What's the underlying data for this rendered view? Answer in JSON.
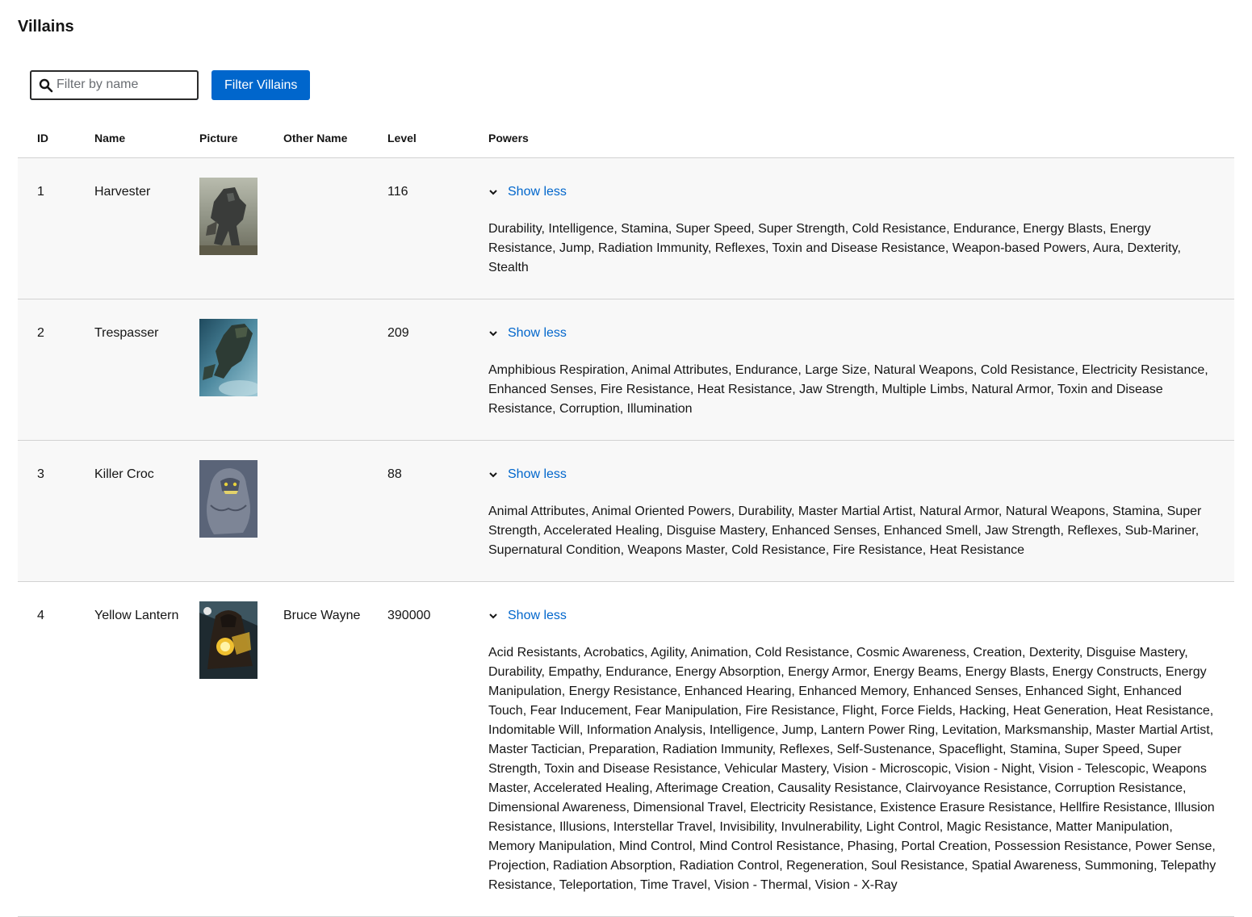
{
  "page": {
    "title": "Villains"
  },
  "toolbar": {
    "search_placeholder": "Filter by name",
    "search_value": "",
    "filter_button_label": "Filter Villains"
  },
  "table": {
    "columns": [
      "ID",
      "Name",
      "Picture",
      "Other Name",
      "Level",
      "Powers"
    ],
    "rows": [
      {
        "id": "1",
        "name": "Harvester",
        "other_name": "",
        "level": "116",
        "toggle_label": "Show less",
        "powers": "Durability, Intelligence, Stamina, Super Speed, Super Strength, Cold Resistance, Endurance, Energy Blasts, Energy Resistance, Jump, Radiation Immunity, Reflexes, Toxin and Disease Resistance, Weapon-based Powers, Aura, Dexterity, Stealth"
      },
      {
        "id": "2",
        "name": "Trespasser",
        "other_name": "",
        "level": "209",
        "toggle_label": "Show less",
        "powers": "Amphibious Respiration, Animal Attributes, Endurance, Large Size, Natural Weapons, Cold Resistance, Electricity Resistance, Enhanced Senses, Fire Resistance, Heat Resistance, Jaw Strength, Multiple Limbs, Natural Armor, Toxin and Disease Resistance, Corruption, Illumination"
      },
      {
        "id": "3",
        "name": "Killer Croc",
        "other_name": "",
        "level": "88",
        "toggle_label": "Show less",
        "powers": "Animal Attributes, Animal Oriented Powers, Durability, Master Martial Artist, Natural Armor, Natural Weapons, Stamina, Super Strength, Accelerated Healing, Disguise Mastery, Enhanced Senses, Enhanced Smell, Jaw Strength, Reflexes, Sub-Mariner, Supernatural Condition, Weapons Master, Cold Resistance, Fire Resistance, Heat Resistance"
      },
      {
        "id": "4",
        "name": "Yellow Lantern",
        "other_name": "Bruce Wayne",
        "level": "390000",
        "toggle_label": "Show less",
        "powers": "Acid Resistants, Acrobatics, Agility, Animation, Cold Resistance, Cosmic Awareness, Creation, Dexterity, Disguise Mastery, Durability, Empathy, Endurance, Energy Absorption, Energy Armor, Energy Beams, Energy Blasts, Energy Constructs, Energy Manipulation, Energy Resistance, Enhanced Hearing, Enhanced Memory, Enhanced Senses, Enhanced Sight, Enhanced Touch, Fear Inducement, Fear Manipulation, Fire Resistance, Flight, Force Fields, Hacking, Heat Generation, Heat Resistance, Indomitable Will, Information Analysis, Intelligence, Jump, Lantern Power Ring, Levitation, Marksmanship, Master Martial Artist, Master Tactician, Preparation, Radiation Immunity, Reflexes, Self-Sustenance, Spaceflight, Stamina, Super Speed, Super Strength, Toxin and Disease Resistance, Vehicular Mastery, Vision - Microscopic, Vision - Night, Vision - Telescopic, Weapons Master, Accelerated Healing, Afterimage Creation, Causality Resistance, Clairvoyance Resistance, Corruption Resistance, Dimensional Awareness, Dimensional Travel, Electricity Resistance, Existence Erasure Resistance, Hellfire Resistance, Illusion Resistance, Illusions, Interstellar Travel, Invisibility, Invulnerability, Light Control, Magic Resistance, Matter Manipulation, Memory Manipulation, Mind Control, Mind Control Resistance, Phasing, Portal Creation, Possession Resistance, Power Sense, Projection, Radiation Absorption, Radiation Control, Regeneration, Soul Resistance, Spatial Awareness, Summoning, Telepathy Resistance, Teleportation, Time Travel, Vision - Thermal, Vision - X-Ray"
      }
    ]
  },
  "icons": {
    "search": "search-icon",
    "toggle": "chevron-down-icon"
  },
  "colors": {
    "accent": "#0066cc",
    "row_gray": "#f8f8f8",
    "border": "#d2d2d2"
  }
}
